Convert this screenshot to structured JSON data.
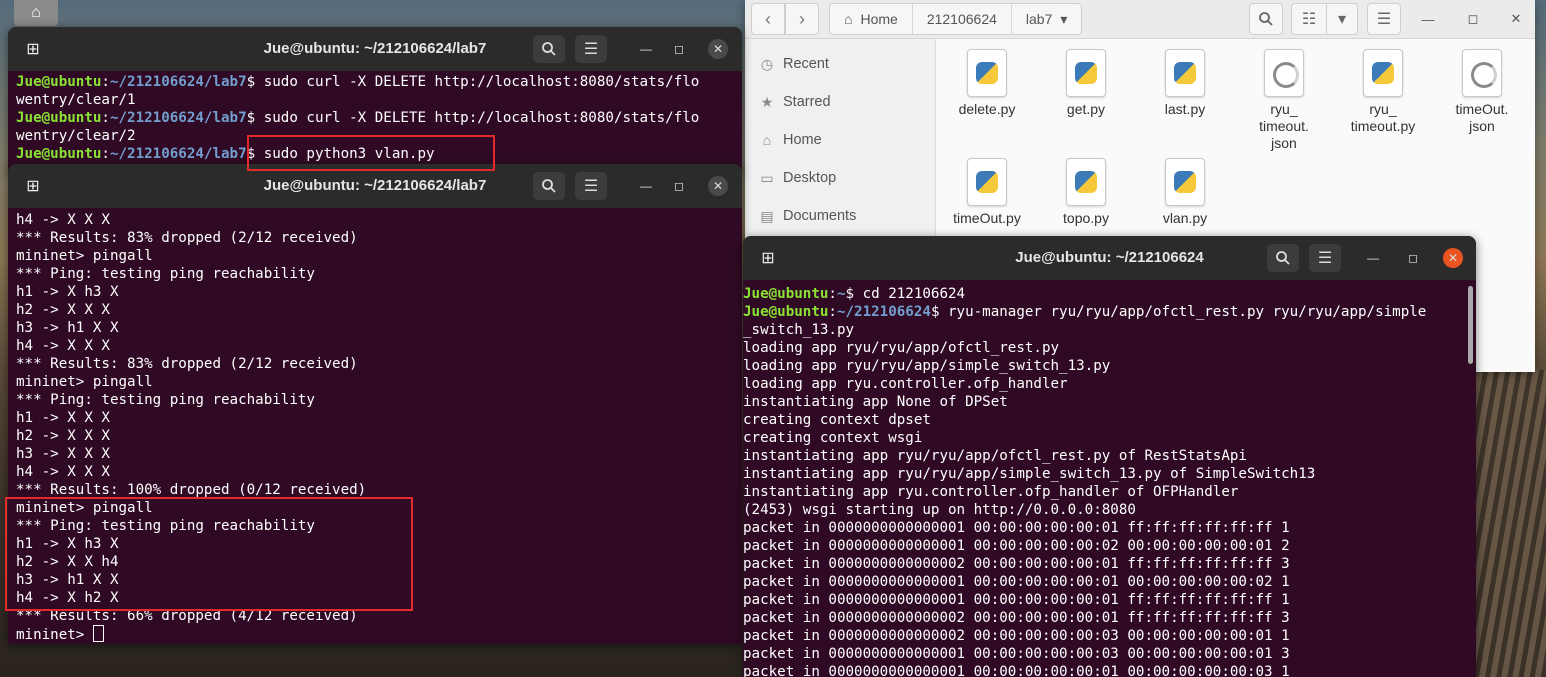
{
  "desktop": {
    "home_icon": "home-icon"
  },
  "term1": {
    "title": "Jue@ubuntu: ~/212106624/lab7",
    "lines": [
      [
        [
          "u",
          "Jue@ubuntu"
        ],
        [
          "t",
          ":"
        ],
        [
          "p",
          "~/212106624/lab7"
        ],
        [
          "t",
          "$ sudo curl -X DELETE http://localhost:8080/stats/flo"
        ]
      ],
      [
        [
          "t",
          "wentry/clear/1"
        ]
      ],
      [
        [
          "u",
          "Jue@ubuntu"
        ],
        [
          "t",
          ":"
        ],
        [
          "p",
          "~/212106624/lab7"
        ],
        [
          "t",
          "$ sudo curl -X DELETE http://localhost:8080/stats/flo"
        ]
      ],
      [
        [
          "t",
          "wentry/clear/2"
        ]
      ],
      [
        [
          "u",
          "Jue@ubuntu"
        ],
        [
          "t",
          ":"
        ],
        [
          "p",
          "~/212106624/lab7"
        ],
        [
          "t",
          "$ sudo python3 vlan.py"
        ]
      ]
    ]
  },
  "term2": {
    "title": "Jue@ubuntu: ~/212106624/lab7",
    "lines": [
      "h4 -> X X X",
      "*** Results: 83% dropped (2/12 received)",
      "mininet> pingall",
      "*** Ping: testing ping reachability",
      "h1 -> X h3 X",
      "h2 -> X X X",
      "h3 -> h1 X X",
      "h4 -> X X X",
      "*** Results: 83% dropped (2/12 received)",
      "mininet> pingall",
      "*** Ping: testing ping reachability",
      "h1 -> X X X",
      "h2 -> X X X",
      "h3 -> X X X",
      "h4 -> X X X",
      "*** Results: 100% dropped (0/12 received)",
      "mininet> pingall",
      "*** Ping: testing ping reachability",
      "h1 -> X h3 X",
      "h2 -> X X h4",
      "h3 -> h1 X X",
      "h4 -> X h2 X",
      "*** Results: 66% dropped (4/12 received)"
    ],
    "prompt": "mininet> "
  },
  "term3": {
    "title": "Jue@ubuntu: ~/212106624",
    "lines": [
      [
        [
          "u",
          "Jue@ubuntu"
        ],
        [
          "t",
          ":"
        ],
        [
          "p",
          "~"
        ],
        [
          "t",
          "$ cd 212106624"
        ]
      ],
      [
        [
          "u",
          "Jue@ubuntu"
        ],
        [
          "t",
          ":"
        ],
        [
          "p",
          "~/212106624"
        ],
        [
          "t",
          "$ ryu-manager ryu/ryu/app/ofctl_rest.py ryu/ryu/app/simple"
        ]
      ],
      [
        [
          "t",
          "_switch_13.py"
        ]
      ],
      [
        [
          "t",
          "loading app ryu/ryu/app/ofctl_rest.py"
        ]
      ],
      [
        [
          "t",
          "loading app ryu/ryu/app/simple_switch_13.py"
        ]
      ],
      [
        [
          "t",
          "loading app ryu.controller.ofp_handler"
        ]
      ],
      [
        [
          "t",
          "instantiating app None of DPSet"
        ]
      ],
      [
        [
          "t",
          "creating context dpset"
        ]
      ],
      [
        [
          "t",
          "creating context wsgi"
        ]
      ],
      [
        [
          "t",
          "instantiating app ryu/ryu/app/ofctl_rest.py of RestStatsApi"
        ]
      ],
      [
        [
          "t",
          "instantiating app ryu/ryu/app/simple_switch_13.py of SimpleSwitch13"
        ]
      ],
      [
        [
          "t",
          "instantiating app ryu.controller.ofp_handler of OFPHandler"
        ]
      ],
      [
        [
          "t",
          "(2453) wsgi starting up on http://0.0.0.0:8080"
        ]
      ],
      [
        [
          "t",
          "packet in 0000000000000001 00:00:00:00:00:01 ff:ff:ff:ff:ff:ff 1"
        ]
      ],
      [
        [
          "t",
          "packet in 0000000000000001 00:00:00:00:00:02 00:00:00:00:00:01 2"
        ]
      ],
      [
        [
          "t",
          "packet in 0000000000000002 00:00:00:00:00:01 ff:ff:ff:ff:ff:ff 3"
        ]
      ],
      [
        [
          "t",
          "packet in 0000000000000001 00:00:00:00:00:01 00:00:00:00:00:02 1"
        ]
      ],
      [
        [
          "t",
          "packet in 0000000000000001 00:00:00:00:00:01 ff:ff:ff:ff:ff:ff 1"
        ]
      ],
      [
        [
          "t",
          "packet in 0000000000000002 00:00:00:00:00:01 ff:ff:ff:ff:ff:ff 3"
        ]
      ],
      [
        [
          "t",
          "packet in 0000000000000002 00:00:00:00:00:03 00:00:00:00:00:01 1"
        ]
      ],
      [
        [
          "t",
          "packet in 0000000000000001 00:00:00:00:00:03 00:00:00:00:00:01 3"
        ]
      ],
      [
        [
          "t",
          "packet in 0000000000000001 00:00:00:00:00:01 00:00:00:00:00:03 1"
        ]
      ]
    ]
  },
  "files": {
    "breadcrumbs": [
      "Home",
      "212106624",
      "lab7"
    ],
    "sidebar": [
      "Recent",
      "Starred",
      "Home",
      "Desktop",
      "Documents"
    ],
    "items": [
      {
        "name": "delete.py",
        "kind": "py"
      },
      {
        "name": "get.py",
        "kind": "py"
      },
      {
        "name": "last.py",
        "kind": "py"
      },
      {
        "name": "ryu_\ntimeout.\njson",
        "kind": "json"
      },
      {
        "name": "ryu_\ntimeout.py",
        "kind": "py"
      },
      {
        "name": "timeOut.\njson",
        "kind": "json"
      },
      {
        "name": "timeOut.py",
        "kind": "py"
      },
      {
        "name": "topo.py",
        "kind": "py"
      },
      {
        "name": "vlan.py",
        "kind": "py"
      }
    ]
  }
}
